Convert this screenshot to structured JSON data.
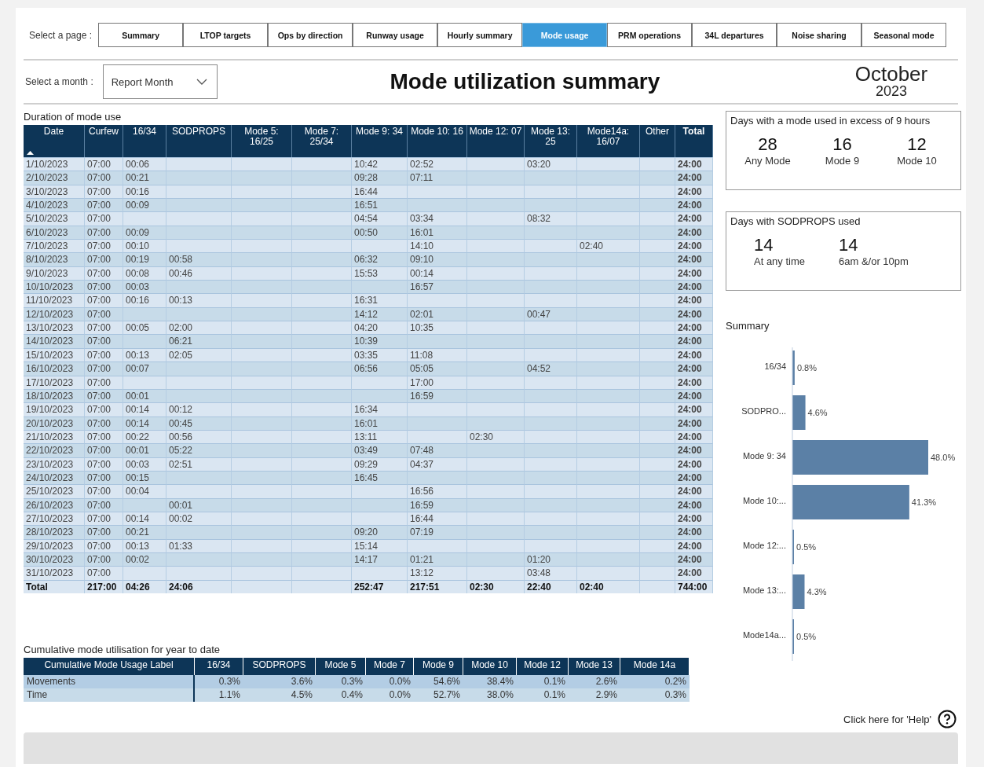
{
  "nav": {
    "label": "Select a page :",
    "tabs": [
      {
        "label": "Summary",
        "selected": false
      },
      {
        "label": "LTOP targets",
        "selected": false
      },
      {
        "label": "Ops by direction",
        "selected": false
      },
      {
        "label": "Runway usage",
        "selected": false
      },
      {
        "label": "Hourly summary",
        "selected": false
      },
      {
        "label": "Mode usage",
        "selected": true
      },
      {
        "label": "PRM operations",
        "selected": false
      },
      {
        "label": "34L departures",
        "selected": false
      },
      {
        "label": "Noise sharing",
        "selected": false
      },
      {
        "label": "Seasonal mode",
        "selected": false
      }
    ]
  },
  "month_select": {
    "label": "Select a month :",
    "value": "Report Month"
  },
  "title": "Mode utilization summary",
  "period": {
    "month": "October",
    "year": "2023"
  },
  "duration_table": {
    "title": "Duration of mode use",
    "columns": [
      "Date",
      "Curfew",
      "16/34",
      "SODPROPS",
      "Mode 5: 16/25",
      "Mode 7: 25/34",
      "Mode 9: 34",
      "Mode 10: 16",
      "Mode 12: 07",
      "Mode 13: 25",
      "Mode14a: 16/07",
      "Other",
      "Total"
    ],
    "rows": [
      {
        "date": "1/10/2023",
        "curfew": "07:00",
        "rwy_16_34": "00:06",
        "mode_9": "10:42",
        "mode_10": "02:52",
        "mode_13": "03:20",
        "total": "24:00"
      },
      {
        "date": "2/10/2023",
        "curfew": "07:00",
        "rwy_16_34": "00:21",
        "mode_9": "09:28",
        "mode_10": "07:11",
        "total": "24:00"
      },
      {
        "date": "3/10/2023",
        "curfew": "07:00",
        "rwy_16_34": "00:16",
        "mode_9": "16:44",
        "total": "24:00"
      },
      {
        "date": "4/10/2023",
        "curfew": "07:00",
        "rwy_16_34": "00:09",
        "mode_9": "16:51",
        "total": "24:00"
      },
      {
        "date": "5/10/2023",
        "curfew": "07:00",
        "mode_9": "04:54",
        "mode_10": "03:34",
        "mode_13": "08:32",
        "total": "24:00"
      },
      {
        "date": "6/10/2023",
        "curfew": "07:00",
        "rwy_16_34": "00:09",
        "mode_9": "00:50",
        "mode_10": "16:01",
        "total": "24:00"
      },
      {
        "date": "7/10/2023",
        "curfew": "07:00",
        "rwy_16_34": "00:10",
        "mode_10": "14:10",
        "mode_14a": "02:40",
        "total": "24:00"
      },
      {
        "date": "8/10/2023",
        "curfew": "07:00",
        "rwy_16_34": "00:19",
        "sodprops": "00:58",
        "mode_9": "06:32",
        "mode_10": "09:10",
        "total": "24:00"
      },
      {
        "date": "9/10/2023",
        "curfew": "07:00",
        "rwy_16_34": "00:08",
        "sodprops": "00:46",
        "mode_9": "15:53",
        "mode_10": "00:14",
        "total": "24:00"
      },
      {
        "date": "10/10/2023",
        "curfew": "07:00",
        "rwy_16_34": "00:03",
        "mode_10": "16:57",
        "total": "24:00"
      },
      {
        "date": "11/10/2023",
        "curfew": "07:00",
        "rwy_16_34": "00:16",
        "sodprops": "00:13",
        "mode_9": "16:31",
        "total": "24:00"
      },
      {
        "date": "12/10/2023",
        "curfew": "07:00",
        "mode_9": "14:12",
        "mode_10": "02:01",
        "mode_13": "00:47",
        "total": "24:00"
      },
      {
        "date": "13/10/2023",
        "curfew": "07:00",
        "rwy_16_34": "00:05",
        "sodprops": "02:00",
        "mode_9": "04:20",
        "mode_10": "10:35",
        "total": "24:00"
      },
      {
        "date": "14/10/2023",
        "curfew": "07:00",
        "sodprops": "06:21",
        "mode_9": "10:39",
        "total": "24:00"
      },
      {
        "date": "15/10/2023",
        "curfew": "07:00",
        "rwy_16_34": "00:13",
        "sodprops": "02:05",
        "mode_9": "03:35",
        "mode_10": "11:08",
        "total": "24:00"
      },
      {
        "date": "16/10/2023",
        "curfew": "07:00",
        "rwy_16_34": "00:07",
        "mode_9": "06:56",
        "mode_10": "05:05",
        "mode_13": "04:52",
        "total": "24:00"
      },
      {
        "date": "17/10/2023",
        "curfew": "07:00",
        "mode_10": "17:00",
        "total": "24:00"
      },
      {
        "date": "18/10/2023",
        "curfew": "07:00",
        "rwy_16_34": "00:01",
        "mode_10": "16:59",
        "total": "24:00"
      },
      {
        "date": "19/10/2023",
        "curfew": "07:00",
        "rwy_16_34": "00:14",
        "sodprops": "00:12",
        "mode_9": "16:34",
        "total": "24:00"
      },
      {
        "date": "20/10/2023",
        "curfew": "07:00",
        "rwy_16_34": "00:14",
        "sodprops": "00:45",
        "mode_9": "16:01",
        "total": "24:00"
      },
      {
        "date": "21/10/2023",
        "curfew": "07:00",
        "rwy_16_34": "00:22",
        "sodprops": "00:56",
        "mode_9": "13:11",
        "mode_12": "02:30",
        "total": "24:00"
      },
      {
        "date": "22/10/2023",
        "curfew": "07:00",
        "rwy_16_34": "00:01",
        "sodprops": "05:22",
        "mode_9": "03:49",
        "mode_10": "07:48",
        "total": "24:00"
      },
      {
        "date": "23/10/2023",
        "curfew": "07:00",
        "rwy_16_34": "00:03",
        "sodprops": "02:51",
        "mode_9": "09:29",
        "mode_10": "04:37",
        "total": "24:00"
      },
      {
        "date": "24/10/2023",
        "curfew": "07:00",
        "rwy_16_34": "00:15",
        "mode_9": "16:45",
        "total": "24:00"
      },
      {
        "date": "25/10/2023",
        "curfew": "07:00",
        "rwy_16_34": "00:04",
        "mode_10": "16:56",
        "total": "24:00"
      },
      {
        "date": "26/10/2023",
        "curfew": "07:00",
        "sodprops": "00:01",
        "mode_10": "16:59",
        "total": "24:00"
      },
      {
        "date": "27/10/2023",
        "curfew": "07:00",
        "rwy_16_34": "00:14",
        "sodprops": "00:02",
        "mode_10": "16:44",
        "total": "24:00"
      },
      {
        "date": "28/10/2023",
        "curfew": "07:00",
        "rwy_16_34": "00:21",
        "mode_9": "09:20",
        "mode_10": "07:19",
        "total": "24:00"
      },
      {
        "date": "29/10/2023",
        "curfew": "07:00",
        "rwy_16_34": "00:13",
        "sodprops": "01:33",
        "mode_9": "15:14",
        "total": "24:00"
      },
      {
        "date": "30/10/2023",
        "curfew": "07:00",
        "rwy_16_34": "00:02",
        "mode_9": "14:17",
        "mode_10": "01:21",
        "mode_13": "01:20",
        "total": "24:00"
      },
      {
        "date": "31/10/2023",
        "curfew": "07:00",
        "mode_10": "13:12",
        "mode_13": "03:48",
        "total": "24:00"
      }
    ],
    "total_row": {
      "date": "Total",
      "curfew": "217:00",
      "rwy_16_34": "04:26",
      "sodprops": "24:06",
      "mode_9": "252:47",
      "mode_10": "217:51",
      "mode_12": "02:30",
      "mode_13": "22:40",
      "mode_14a": "02:40",
      "total": "744:00"
    }
  },
  "excess_card": {
    "title": "Days with a mode used in excess of 9 hours",
    "stats": [
      {
        "value": "28",
        "label": "Any Mode"
      },
      {
        "value": "16",
        "label": "Mode 9"
      },
      {
        "value": "12",
        "label": "Mode 10"
      }
    ]
  },
  "sodprops_card": {
    "title": "Days with SODPROPS used",
    "stats": [
      {
        "value": "14",
        "label": "At any time"
      },
      {
        "value": "14",
        "label": "6am &/or 10pm"
      }
    ]
  },
  "summary": {
    "title": "Summary",
    "chart_data": {
      "type": "bar",
      "orientation": "horizontal",
      "categories": [
        "16/34",
        "SODPRO...",
        "Mode 9: 34",
        "Mode 10:...",
        "Mode 12:...",
        "Mode 13:...",
        "Mode14a..."
      ],
      "series": [
        {
          "color": "#5b80a6",
          "values": [
            0.8,
            4.6,
            48.0,
            41.3,
            0.5,
            4.3,
            0.5
          ],
          "value_labels": [
            "0.8%",
            "4.6%",
            "48.0%",
            "41.3%",
            "0.5%",
            "4.3%",
            "0.5%"
          ]
        }
      ],
      "data_labels": true
    }
  },
  "cumulative_table": {
    "title": "Cumulative mode utilisation for year to date",
    "columns": [
      "Cumulative Mode Usage Label",
      "16/34",
      "SODPROPS",
      "Mode 5",
      "Mode 7",
      "Mode 9",
      "Mode 10",
      "Mode 12",
      "Mode 13",
      "Mode 14a"
    ],
    "rows": [
      [
        "Movements",
        "0.3%",
        "3.6%",
        "0.3%",
        "0.0%",
        "54.6%",
        "38.4%",
        "0.1%",
        "2.6%",
        "0.2%"
      ],
      [
        "Time",
        "1.1%",
        "4.5%",
        "0.4%",
        "0.0%",
        "52.7%",
        "38.0%",
        "0.1%",
        "2.9%",
        "0.3%"
      ]
    ]
  },
  "help": {
    "label": "Click here for 'Help'"
  }
}
